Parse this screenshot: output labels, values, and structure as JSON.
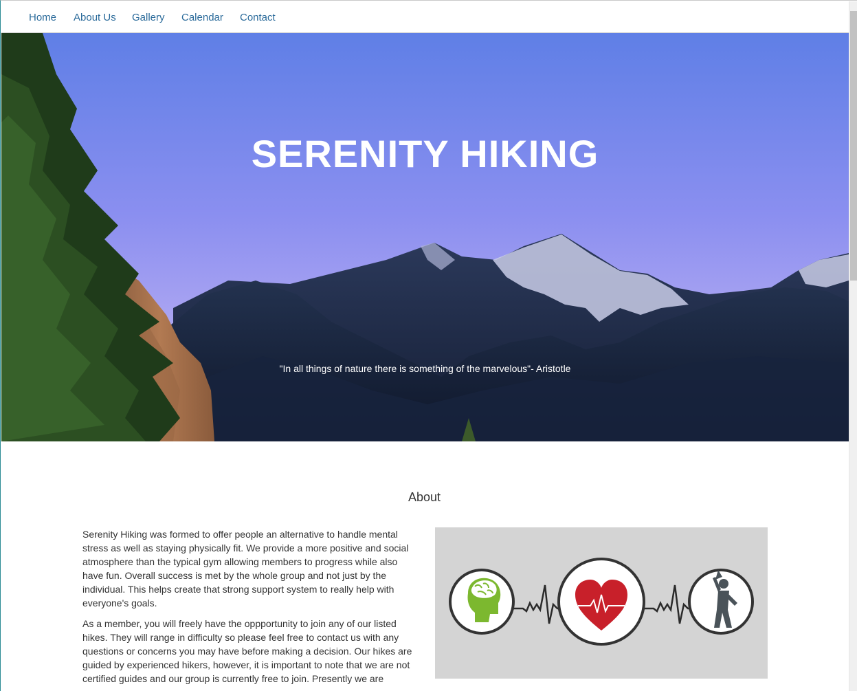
{
  "nav": {
    "items": [
      {
        "label": "Home"
      },
      {
        "label": "About Us"
      },
      {
        "label": "Gallery"
      },
      {
        "label": "Calendar"
      },
      {
        "label": "Contact"
      }
    ]
  },
  "hero": {
    "title": "SERENITY HIKING",
    "quote": "\"In all things of nature there is something of the marvelous\"- Aristotle"
  },
  "about": {
    "heading": "About",
    "paragraphs": [
      "Serenity Hiking was formed to offer people an alternative to handle mental stress as well as staying physically fit. We provide a more positive and social atmosphere than the typical gym allowing members to progress while also have fun. Overall success is met by the whole group and not just by the individual. This helps create that strong support system to really help with everyone's goals.",
      "As a member, you will freely have the oppportunity to join any of our listed hikes. They will range in difficulty so please feel free to contact us with any questions or concerns you may have before making a decision. Our hikes are guided by experienced hikers, however, it is important to note that we are not certified guides and our group is currently free to join. Presently we are"
    ],
    "image_icons": [
      "brain-head-icon",
      "heart-icon",
      "stretching-person-icon"
    ]
  },
  "colors": {
    "nav_link": "#2a6a9a",
    "image_bg": "#d4d4d4",
    "heart_red": "#c8202a",
    "brain_green": "#7cb82f",
    "figure_gray": "#4a5359"
  }
}
